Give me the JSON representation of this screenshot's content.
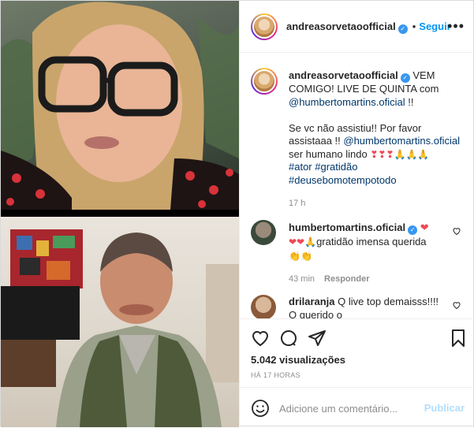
{
  "post": {
    "username": "andreasorvetaoofficial",
    "follow_label": "Seguir",
    "more_label": "•••"
  },
  "caption": {
    "username": "andreasorvetaoofficial",
    "line1": "VEM COMIGO! LIVE DE QUINTA com",
    "mention": "@humbertomartins.oficial",
    "line1_end": " !!",
    "line2_pre": "Se vc não assistiu!! Por favor assistaaa !! ",
    "mention2": "@humbertomartins.oficial",
    "line2_post": " ser humano lindo ",
    "emojis": "❣❣❣🙏🙏🙏",
    "hashtag1": "#ator",
    "hashtag2": "#gratidão",
    "hashtag3": "#deusebomotempotodo",
    "time": "17 h"
  },
  "comments": [
    {
      "username": "humbertomartins.oficial",
      "heart_emoji": "❤",
      "text_emojis": "❤❤🙏",
      "text": "gratidão imensa querida",
      "trailing_emojis": "👏👏",
      "time": "43 min",
      "reply_label": "Responder"
    },
    {
      "username": "drilaranja",
      "text": "Q live top demaisss!!!! O querido o"
    }
  ],
  "stats": {
    "views": "5.042 visualizações",
    "posted": "HÁ 17 HORAS"
  },
  "comment_form": {
    "placeholder": "Adicione um comentário...",
    "publish_label": "Publicar"
  },
  "colors": {
    "accent": "#0095f6",
    "link": "#00376b",
    "muted": "#8e8e8e",
    "heart": "#ed4956"
  }
}
